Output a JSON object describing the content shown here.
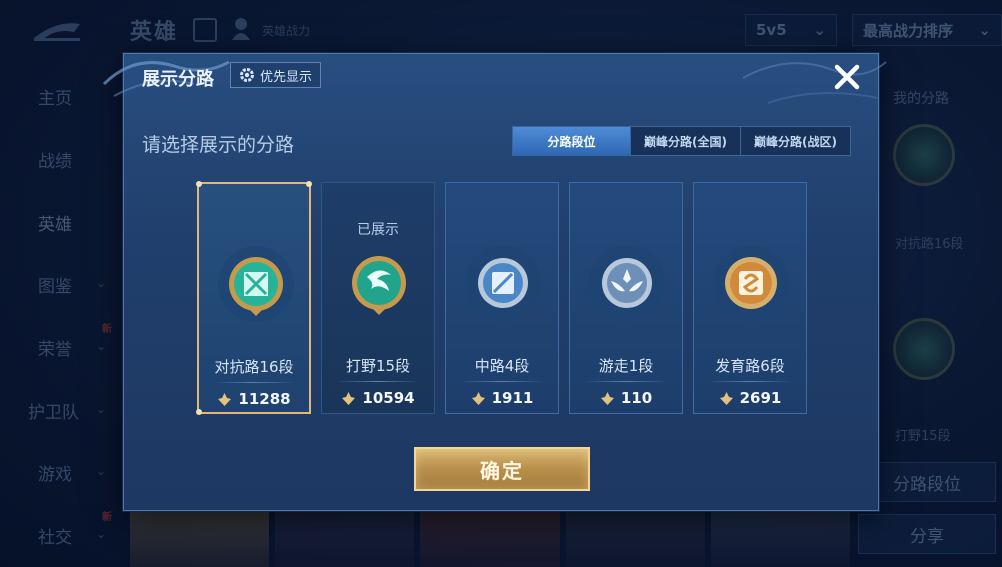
{
  "background": {
    "top_title": "英雄",
    "top_subtitle": "英雄战力",
    "mode_select": "5v5",
    "sort_select": "最高战力排序",
    "nav": [
      {
        "label": "主页",
        "chevron": false,
        "new": false
      },
      {
        "label": "战绩",
        "chevron": false,
        "new": false
      },
      {
        "label": "英雄",
        "chevron": false,
        "new": false,
        "active": true
      },
      {
        "label": "图鉴",
        "chevron": true,
        "new": false
      },
      {
        "label": "荣誉",
        "chevron": true,
        "new": true
      },
      {
        "label": "护卫队",
        "chevron": true,
        "new": false
      },
      {
        "label": "游戏",
        "chevron": true,
        "new": false
      },
      {
        "label": "社交",
        "chevron": true,
        "new": true
      }
    ],
    "new_badge": "新",
    "right_panel": {
      "title": "我的分路",
      "lane1_label": "对抗路16段",
      "lane2_label": "打野15段",
      "lane_rank_button": "分路段位",
      "share_button": "分享"
    }
  },
  "modal": {
    "title": "展示分路",
    "priority_button": "优先显示",
    "subtitle": "请选择展示的分路",
    "tabs": [
      {
        "label": "分路段位",
        "active": true
      },
      {
        "label": "巅峰分路(全国)",
        "active": false
      },
      {
        "label": "巅峰分路(战区)",
        "active": false
      }
    ],
    "shown_label": "已展示",
    "cards": [
      {
        "name": "对抗路16段",
        "score": "11288",
        "selected": true,
        "shown": false,
        "emblem": "clash-lane-emblem-icon",
        "color": "#27b39a"
      },
      {
        "name": "打野15段",
        "score": "10594",
        "selected": false,
        "shown": true,
        "emblem": "jungle-emblem-icon",
        "color": "#22a48c"
      },
      {
        "name": "中路4段",
        "score": "1911",
        "selected": false,
        "shown": false,
        "emblem": "mid-lane-emblem-icon",
        "color": "#4a86c8"
      },
      {
        "name": "游走1段",
        "score": "110",
        "selected": false,
        "shown": false,
        "emblem": "roam-emblem-icon",
        "color": "#6d8fb8"
      },
      {
        "name": "发育路6段",
        "score": "2691",
        "selected": false,
        "shown": false,
        "emblem": "farm-lane-emblem-icon",
        "color": "#d08a3a"
      }
    ],
    "confirm_button": "确定"
  },
  "colors": {
    "accent_gold": "#e2b777",
    "tab_active": "#3f7bc9",
    "modal_bg": "#234574"
  }
}
